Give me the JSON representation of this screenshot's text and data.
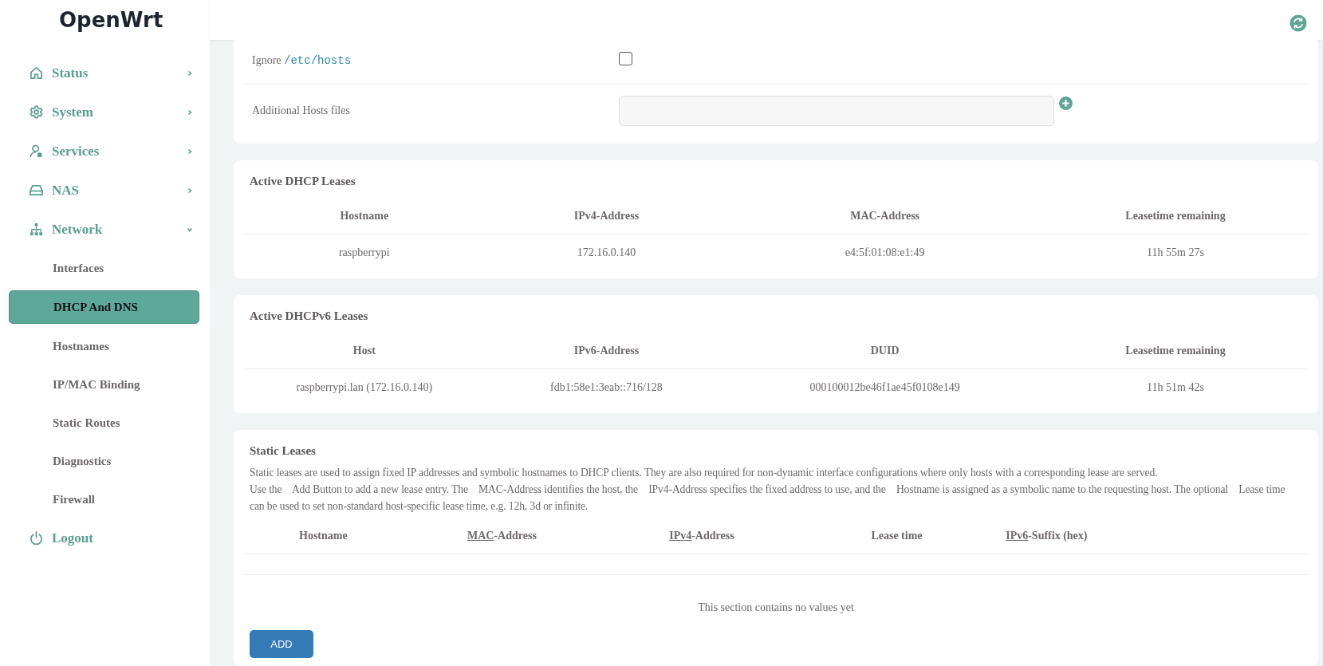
{
  "brand": "OpenWrt",
  "sidebar": {
    "items": [
      {
        "label": "Status",
        "expanded": false
      },
      {
        "label": "System",
        "expanded": false
      },
      {
        "label": "Services",
        "expanded": false
      },
      {
        "label": "NAS",
        "expanded": false
      },
      {
        "label": "Network",
        "expanded": true,
        "children": [
          {
            "label": "Interfaces",
            "selected": false
          },
          {
            "label": "DHCP And DNS",
            "selected": true
          },
          {
            "label": "Hostnames",
            "selected": false
          },
          {
            "label": "IP/MAC Binding",
            "selected": false
          },
          {
            "label": "Static Routes",
            "selected": false
          },
          {
            "label": "Diagnostics",
            "selected": false
          },
          {
            "label": "Firewall",
            "selected": false
          }
        ]
      }
    ],
    "logout": "Logout"
  },
  "settings": {
    "ignore_hosts": {
      "label": "Ignore",
      "code": "/etc/hosts",
      "checked": false
    },
    "additional_hosts": {
      "label": "Additional Hosts files"
    }
  },
  "dhcp_leases": {
    "title": "Active DHCP Leases",
    "columns": [
      "Hostname",
      "IPv4-Address",
      "MAC-Address",
      "Leasetime remaining"
    ],
    "rows": [
      [
        "raspberrypi",
        "172.16.0.140",
        "e4:5f:01:08:e1:49",
        "11h 55m 27s"
      ]
    ]
  },
  "dhcpv6_leases": {
    "title": "Active DHCPv6 Leases",
    "columns": [
      "Host",
      "IPv6-Address",
      "DUID",
      "Leasetime remaining"
    ],
    "rows": [
      [
        "raspberrypi.lan (172.16.0.140)",
        "fdb1:58e1:3eab::716/128",
        "000100012be46f1ae45f0108e149",
        "11h 51m 42s"
      ]
    ]
  },
  "static_leases": {
    "title": "Static Leases",
    "description": [
      "Static leases are used to assign fixed IP addresses and symbolic hostnames to DHCP clients. They are also required for non-dynamic interface configurations where only hosts with a corresponding lease are served.",
      "Use the    Add Button to add a new lease entry. The    MAC-Address identifies the host, the    IPv4-Address specifies the fixed address to use, and the    Hostname is assigned as a symbolic name to the requesting host. The optional    Lease time can be used to set non-standard host-specific lease time, e.g. 12h, 3d or infinite."
    ],
    "columns": [
      {
        "text": "Hostname"
      },
      {
        "abbr": "MAC",
        "text": "-Address"
      },
      {
        "abbr": "IPv4",
        "text": "-Address"
      },
      {
        "text": "Lease time"
      },
      {
        "abbr": "IPv6",
        "text": "-Suffix (hex)"
      }
    ],
    "empty": "This section contains no values yet",
    "add_button": "ADD"
  }
}
